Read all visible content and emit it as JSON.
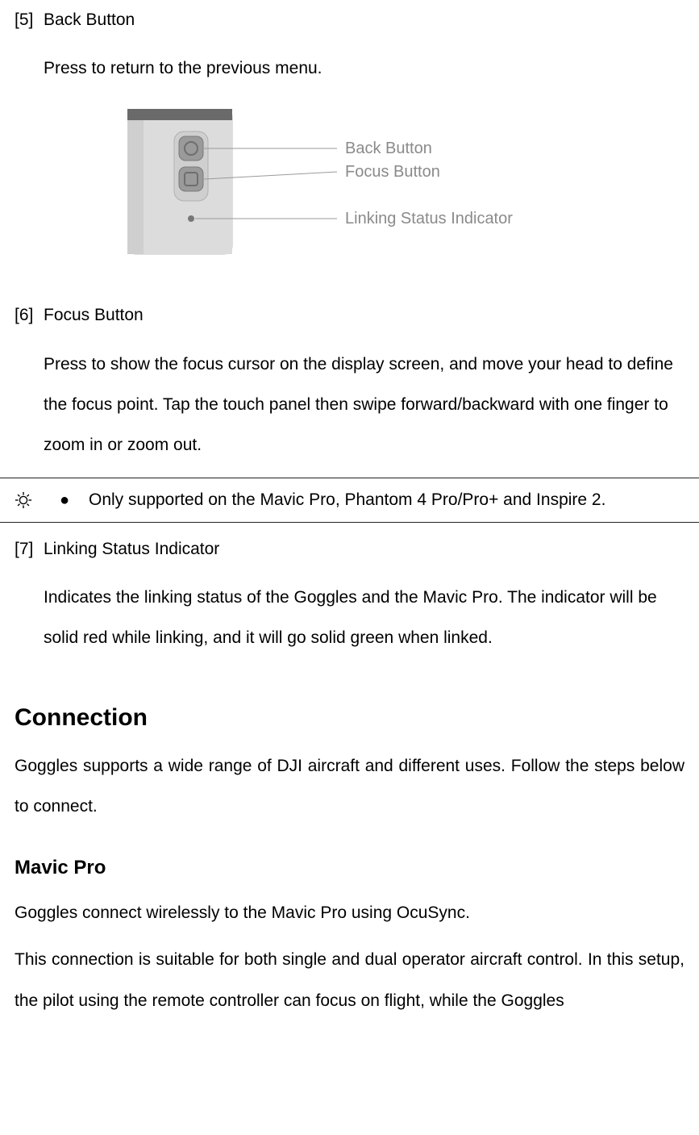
{
  "item5": {
    "num": "[5]",
    "title": "Back Button",
    "desc": "Press to return to the previous menu."
  },
  "diagram": {
    "label1": "Back Button",
    "label2": "Focus Button",
    "label3": "Linking Status Indicator"
  },
  "item6": {
    "num": "[6]",
    "title": "Focus Button",
    "desc": "Press to show the focus cursor on the display screen, and move your head to define the focus point. Tap the touch panel then swipe forward/backward with one finger to zoom in or zoom out."
  },
  "note": {
    "text": "Only supported on the Mavic Pro, Phantom 4 Pro/Pro+ and Inspire 2."
  },
  "item7": {
    "num": "[7]",
    "title": "Linking Status Indicator",
    "desc": "Indicates the linking status of the Goggles and the Mavic Pro. The indicator will be solid red while linking, and it will go solid green when linked."
  },
  "connection": {
    "heading": "Connection",
    "intro": "Goggles supports a wide range of DJI aircraft and different uses. Follow the steps below to connect."
  },
  "mavic": {
    "heading": "Mavic Pro",
    "p1": "Goggles connect wirelessly to the Mavic Pro using OcuSync.",
    "p2": "This connection is suitable for both single and dual operator aircraft control. In this setup, the pilot using the remote controller can focus on flight, while the Goggles"
  }
}
